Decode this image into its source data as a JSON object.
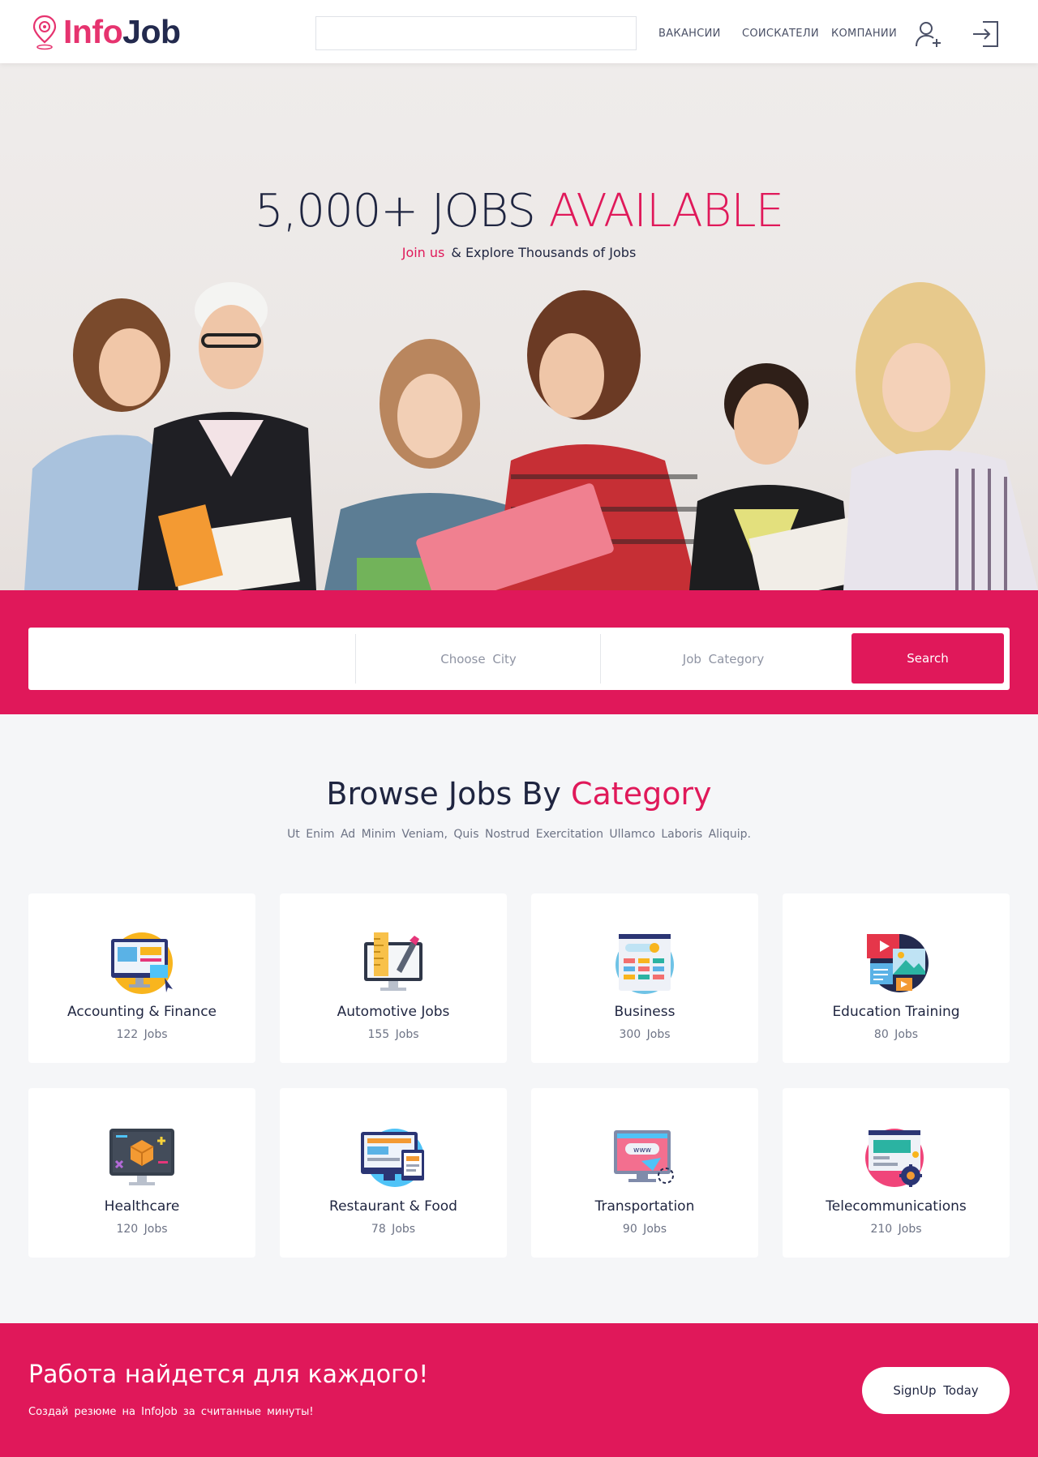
{
  "header": {
    "logo": {
      "part1": "Info",
      "part2": "Job"
    },
    "search_placeholder": "",
    "nav": [
      "ВАКАНСИИ",
      "СОИСКАТЕЛИ",
      "КОМПАНИИ"
    ]
  },
  "hero": {
    "title_dark": "5,000+ JOBS",
    "title_pink": "AVAILABLE",
    "sub_pink": "Join us",
    "sub_rest": "& Explore Thousands of Jobs"
  },
  "search": {
    "city": "Choose City",
    "category": "Job Category",
    "button": "Search"
  },
  "categories": {
    "title_dark": "Browse Jobs By",
    "title_pink": "Category",
    "subtitle": "Ut Enim Ad Minim Veniam, Quis Nostrud Exercitation Ullamco Laboris Aliquip.",
    "items": [
      {
        "name": "Accounting & Finance",
        "count": "122 Jobs",
        "icon": "accounting-icon"
      },
      {
        "name": "Automotive Jobs",
        "count": "155 Jobs",
        "icon": "automotive-icon"
      },
      {
        "name": "Business",
        "count": "300 Jobs",
        "icon": "business-icon"
      },
      {
        "name": "Education Training",
        "count": "80 Jobs",
        "icon": "education-icon"
      },
      {
        "name": "Healthcare",
        "count": "120 Jobs",
        "icon": "healthcare-icon"
      },
      {
        "name": "Restaurant & Food",
        "count": "78 Jobs",
        "icon": "restaurant-icon"
      },
      {
        "name": "Transportation",
        "count": "90 Jobs",
        "icon": "transportation-icon"
      },
      {
        "name": "Telecommunications",
        "count": "210 Jobs",
        "icon": "telecom-icon"
      }
    ]
  },
  "cta": {
    "title": "Работа найдется для каждого!",
    "subtitle": "Создай резюме на InfoJob за считанные минуты!",
    "button": "SignUp Today"
  },
  "colors": {
    "accent": "#e0185a",
    "dark": "#1f2540"
  }
}
